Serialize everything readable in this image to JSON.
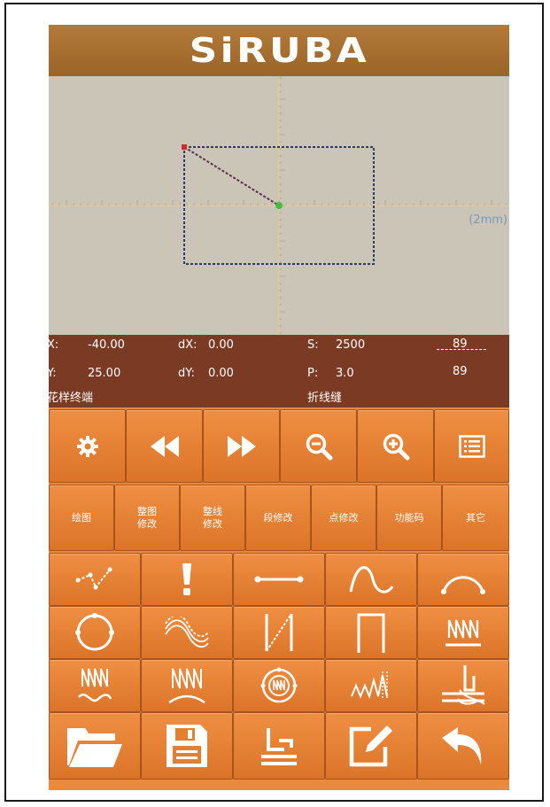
{
  "header": {
    "brand": "SiRUBA"
  },
  "canvas": {
    "scale_label": "(2mm)"
  },
  "info": {
    "x_label": "X:",
    "x_value": "-40.00",
    "y_label": "Y:",
    "y_value": "25.00",
    "dx_label": "dX:",
    "dx_value": "0.00",
    "dy_label": "dY:",
    "dy_value": "0.00",
    "s_label": "S:",
    "s_value": "2500",
    "p_label": "P:",
    "p_value": "3.0",
    "count_top": "89",
    "count_bottom": "89",
    "point_status": "花样终端",
    "stitch_type": "折线缝"
  },
  "toolbar_top": {
    "icons": [
      "gear-icon",
      "rewind-icon",
      "fast-forward-icon",
      "zoom-out-icon",
      "zoom-in-icon",
      "list-icon"
    ]
  },
  "mode_tabs": [
    {
      "lines": [
        "绘图"
      ]
    },
    {
      "lines": [
        "整图",
        "修改"
      ]
    },
    {
      "lines": [
        "整线",
        "修改"
      ]
    },
    {
      "lines": [
        "段修改"
      ]
    },
    {
      "lines": [
        "点修改"
      ]
    },
    {
      "lines": [
        "功能码"
      ]
    },
    {
      "lines": [
        "其它"
      ]
    }
  ],
  "tools": {
    "row1": [
      "polyline-icon",
      "exclamation-icon",
      "straight-line-icon",
      "curve-icon",
      "arc-icon"
    ],
    "row2": [
      "circle-icon",
      "multi-curve-icon",
      "zigzag-line-icon",
      "rectangle-icon",
      "zigzag-stitch-icon"
    ],
    "row3": [
      "zigzag-wave-icon",
      "zigzag-arc-icon",
      "zigzag-circle-icon",
      "triple-zigzag-icon",
      "presser-foot-icon"
    ],
    "row4": [
      "folder-open-icon",
      "save-icon",
      "sewing-test-icon",
      "edit-icon",
      "return-icon"
    ]
  },
  "colors": {
    "header": "#a66f30",
    "canvas": "#cbc5b8",
    "info_panel": "#7a3a23",
    "button": "#e3802f",
    "pattern_line": "#2e3a6e",
    "start_point": "#3fbf3f",
    "end_point": "#d22a2a"
  }
}
